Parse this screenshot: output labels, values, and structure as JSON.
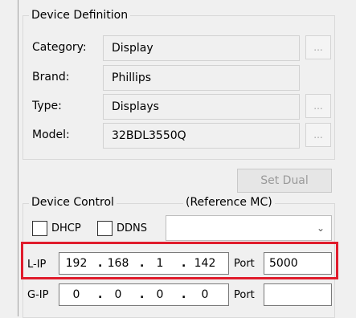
{
  "device_definition": {
    "title": "Device Definition",
    "category": {
      "label": "Category:",
      "value": "Display"
    },
    "brand": {
      "label": "Brand:",
      "value": "Phillips"
    },
    "type": {
      "label": "Type:",
      "value": "Displays"
    },
    "model": {
      "label": "Model:",
      "value": "32BDL3550Q"
    },
    "browse_label": "..."
  },
  "set_dual_label": "Set Dual",
  "device_control": {
    "title": "Device Control",
    "reference_label": "(Reference MC)",
    "dhcp_label": "DHCP",
    "ddns_label": "DDNS",
    "reference_value": ""
  },
  "lip": {
    "label": "L-IP",
    "octets": [
      "192",
      "168",
      "1",
      "142"
    ],
    "port_label": "Port",
    "port_value": "5000"
  },
  "gip": {
    "label": "G-IP",
    "octets": [
      "0",
      "0",
      "0",
      "0"
    ],
    "port_label": "Port",
    "port_value": ""
  }
}
